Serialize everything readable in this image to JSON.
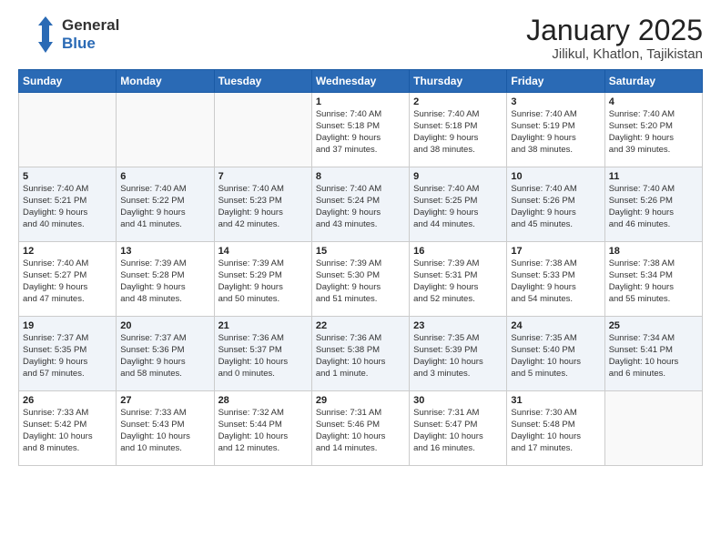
{
  "header": {
    "logo_general": "General",
    "logo_blue": "Blue",
    "title": "January 2025",
    "subtitle": "Jilikul, Khatlon, Tajikistan"
  },
  "days_of_week": [
    "Sunday",
    "Monday",
    "Tuesday",
    "Wednesday",
    "Thursday",
    "Friday",
    "Saturday"
  ],
  "weeks": [
    [
      {
        "day": "",
        "info": ""
      },
      {
        "day": "",
        "info": ""
      },
      {
        "day": "",
        "info": ""
      },
      {
        "day": "1",
        "info": "Sunrise: 7:40 AM\nSunset: 5:18 PM\nDaylight: 9 hours\nand 37 minutes."
      },
      {
        "day": "2",
        "info": "Sunrise: 7:40 AM\nSunset: 5:18 PM\nDaylight: 9 hours\nand 38 minutes."
      },
      {
        "day": "3",
        "info": "Sunrise: 7:40 AM\nSunset: 5:19 PM\nDaylight: 9 hours\nand 38 minutes."
      },
      {
        "day": "4",
        "info": "Sunrise: 7:40 AM\nSunset: 5:20 PM\nDaylight: 9 hours\nand 39 minutes."
      }
    ],
    [
      {
        "day": "5",
        "info": "Sunrise: 7:40 AM\nSunset: 5:21 PM\nDaylight: 9 hours\nand 40 minutes."
      },
      {
        "day": "6",
        "info": "Sunrise: 7:40 AM\nSunset: 5:22 PM\nDaylight: 9 hours\nand 41 minutes."
      },
      {
        "day": "7",
        "info": "Sunrise: 7:40 AM\nSunset: 5:23 PM\nDaylight: 9 hours\nand 42 minutes."
      },
      {
        "day": "8",
        "info": "Sunrise: 7:40 AM\nSunset: 5:24 PM\nDaylight: 9 hours\nand 43 minutes."
      },
      {
        "day": "9",
        "info": "Sunrise: 7:40 AM\nSunset: 5:25 PM\nDaylight: 9 hours\nand 44 minutes."
      },
      {
        "day": "10",
        "info": "Sunrise: 7:40 AM\nSunset: 5:26 PM\nDaylight: 9 hours\nand 45 minutes."
      },
      {
        "day": "11",
        "info": "Sunrise: 7:40 AM\nSunset: 5:26 PM\nDaylight: 9 hours\nand 46 minutes."
      }
    ],
    [
      {
        "day": "12",
        "info": "Sunrise: 7:40 AM\nSunset: 5:27 PM\nDaylight: 9 hours\nand 47 minutes."
      },
      {
        "day": "13",
        "info": "Sunrise: 7:39 AM\nSunset: 5:28 PM\nDaylight: 9 hours\nand 48 minutes."
      },
      {
        "day": "14",
        "info": "Sunrise: 7:39 AM\nSunset: 5:29 PM\nDaylight: 9 hours\nand 50 minutes."
      },
      {
        "day": "15",
        "info": "Sunrise: 7:39 AM\nSunset: 5:30 PM\nDaylight: 9 hours\nand 51 minutes."
      },
      {
        "day": "16",
        "info": "Sunrise: 7:39 AM\nSunset: 5:31 PM\nDaylight: 9 hours\nand 52 minutes."
      },
      {
        "day": "17",
        "info": "Sunrise: 7:38 AM\nSunset: 5:33 PM\nDaylight: 9 hours\nand 54 minutes."
      },
      {
        "day": "18",
        "info": "Sunrise: 7:38 AM\nSunset: 5:34 PM\nDaylight: 9 hours\nand 55 minutes."
      }
    ],
    [
      {
        "day": "19",
        "info": "Sunrise: 7:37 AM\nSunset: 5:35 PM\nDaylight: 9 hours\nand 57 minutes."
      },
      {
        "day": "20",
        "info": "Sunrise: 7:37 AM\nSunset: 5:36 PM\nDaylight: 9 hours\nand 58 minutes."
      },
      {
        "day": "21",
        "info": "Sunrise: 7:36 AM\nSunset: 5:37 PM\nDaylight: 10 hours\nand 0 minutes."
      },
      {
        "day": "22",
        "info": "Sunrise: 7:36 AM\nSunset: 5:38 PM\nDaylight: 10 hours\nand 1 minute."
      },
      {
        "day": "23",
        "info": "Sunrise: 7:35 AM\nSunset: 5:39 PM\nDaylight: 10 hours\nand 3 minutes."
      },
      {
        "day": "24",
        "info": "Sunrise: 7:35 AM\nSunset: 5:40 PM\nDaylight: 10 hours\nand 5 minutes."
      },
      {
        "day": "25",
        "info": "Sunrise: 7:34 AM\nSunset: 5:41 PM\nDaylight: 10 hours\nand 6 minutes."
      }
    ],
    [
      {
        "day": "26",
        "info": "Sunrise: 7:33 AM\nSunset: 5:42 PM\nDaylight: 10 hours\nand 8 minutes."
      },
      {
        "day": "27",
        "info": "Sunrise: 7:33 AM\nSunset: 5:43 PM\nDaylight: 10 hours\nand 10 minutes."
      },
      {
        "day": "28",
        "info": "Sunrise: 7:32 AM\nSunset: 5:44 PM\nDaylight: 10 hours\nand 12 minutes."
      },
      {
        "day": "29",
        "info": "Sunrise: 7:31 AM\nSunset: 5:46 PM\nDaylight: 10 hours\nand 14 minutes."
      },
      {
        "day": "30",
        "info": "Sunrise: 7:31 AM\nSunset: 5:47 PM\nDaylight: 10 hours\nand 16 minutes."
      },
      {
        "day": "31",
        "info": "Sunrise: 7:30 AM\nSunset: 5:48 PM\nDaylight: 10 hours\nand 17 minutes."
      },
      {
        "day": "",
        "info": ""
      }
    ]
  ]
}
